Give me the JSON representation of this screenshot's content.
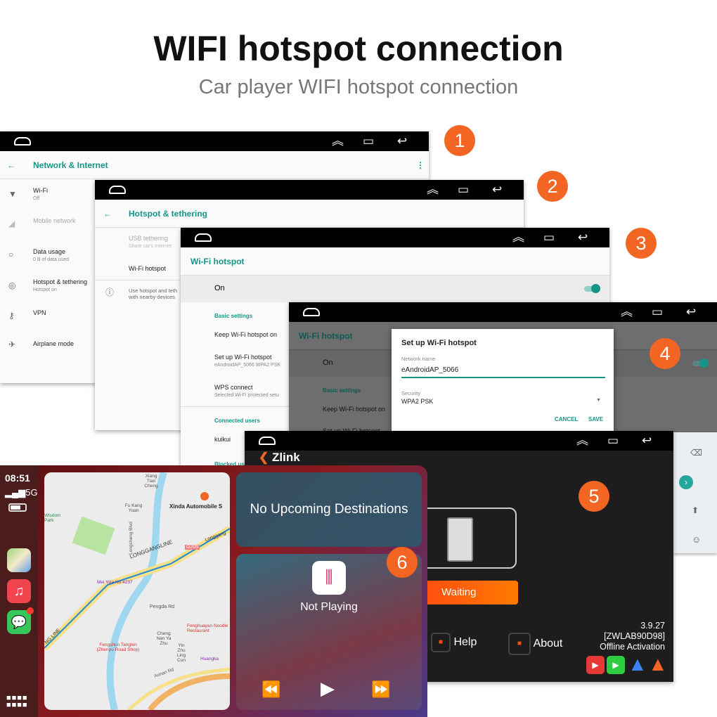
{
  "heading": {
    "title": "WIFI hotspot connection",
    "subtitle": "Car player WIFI hotspot connection"
  },
  "colors": {
    "accent": "#159588",
    "badge": "#f26522",
    "waiting": "#ff5a10"
  },
  "steps": [
    "1",
    "2",
    "3",
    "4",
    "5",
    "6"
  ],
  "panel1": {
    "title": "Network & Internet",
    "items": [
      {
        "label": "Wi-Fi",
        "sub": "Off",
        "icon": "wifi-icon"
      },
      {
        "label": "Mobile network",
        "sub": "",
        "icon": "signal-icon"
      },
      {
        "label": "Data usage",
        "sub": "0 B of data used",
        "icon": "data-usage-icon"
      },
      {
        "label": "Hotspot & tethering",
        "sub": "Hotspot on",
        "icon": "hotspot-icon"
      },
      {
        "label": "VPN",
        "sub": "",
        "icon": "key-icon"
      },
      {
        "label": "Airplane mode",
        "sub": "",
        "icon": "airplane-icon"
      }
    ]
  },
  "panel2": {
    "title": "Hotspot & tethering",
    "usb": "USB tethering",
    "usb_sub": "Share car's Internet",
    "wifi": "Wi-Fi hotspot",
    "info": "Use hotspot and teth",
    "info2": "with nearby devices"
  },
  "panel3": {
    "title": "Wi-Fi hotspot",
    "on": "On",
    "basic": "Basic settings",
    "keep": "Keep Wi-Fi hotspot on",
    "setup": "Set up Wi-Fi hotspot",
    "setup_sub": "eAndroidAP_5066 WPA2 PSK",
    "wps": "WPS connect",
    "wps_sub": "Selected Wi-Fi protected setu",
    "connected": "Connected users",
    "user": "kuikui",
    "blocked": "Blocked users"
  },
  "panel4": {
    "title": "Wi-Fi hotspot",
    "on": "On",
    "basic": "Basic settings",
    "keep": "Keep Wi-Fi hotspot on",
    "setup": "Set up Wi-Fi hotspot",
    "dialog": {
      "title": "Set up Wi-Fi hotspot",
      "name_label": "Network name",
      "name_value": "eAndroidAP_5066",
      "security_label": "Security",
      "security_value": "WPA2 PSK",
      "cancel": "CANCEL",
      "save": "SAVE"
    }
  },
  "panel5": {
    "logo": "Zlink",
    "waiting": "Waiting",
    "help": "Help",
    "about": "About",
    "version": "3.9.27",
    "code": "[ZWLAB90D98]",
    "activation": "Offline Activation"
  },
  "panel6": {
    "time": "08:51",
    "network": "5G",
    "destinations": "No Upcoming Destinations",
    "now_playing": "Not Playing",
    "map_labels": [
      "Xinda Automobile S",
      "LONGGANGLINE",
      "G205",
      "Longgang",
      "Mei Yijia No 4237",
      "Fu Kang Yuan",
      "Xiang Tian Cheng",
      "Pengda Rd",
      "Fenghuayan Noodle Restaurant",
      "Fengshun Tanglen (Zhenpu Road Shop)",
      "Cheng Nan Ya Zhu",
      "Yin Zhu Ling Cun",
      "Huangka",
      "Aonan Rd",
      "Longcheng Blvd",
      "Wisdom Park",
      "NG LINE"
    ]
  }
}
